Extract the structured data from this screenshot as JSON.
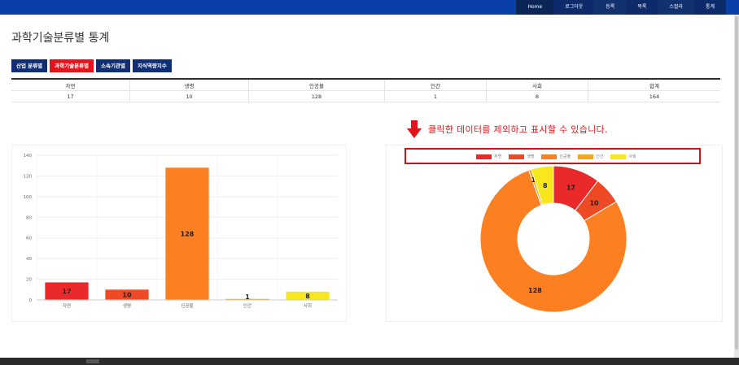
{
  "nav": {
    "items": [
      "Home",
      "로그아웃",
      "등록",
      "목록",
      "스컬라",
      "통계"
    ]
  },
  "page": {
    "title": "과학기술분류별 통계"
  },
  "tabs": [
    {
      "label": "산업 분류별",
      "active": false
    },
    {
      "label": "과학기술분류별",
      "active": true
    },
    {
      "label": "소속기관별",
      "active": false
    },
    {
      "label": "지식역량지수",
      "active": false
    }
  ],
  "table": {
    "headers": [
      "자연",
      "생명",
      "인공물",
      "인간",
      "사회",
      "합계"
    ],
    "values": [
      "17",
      "10",
      "128",
      "1",
      "8",
      "164"
    ]
  },
  "hint": {
    "text": "클릭한 데이터를 제외하고 표시할 수 있습니다."
  },
  "colors": {
    "nav_bg": "#0a3fa8",
    "tab_active": "#e8131a",
    "tab_default": "#0f2e75",
    "hint_red": "#e2141b"
  },
  "chart_data": [
    {
      "type": "bar",
      "categories": [
        "자연",
        "생명",
        "인공물",
        "인간",
        "사회"
      ],
      "values": [
        17,
        10,
        128,
        1,
        8
      ],
      "colors": [
        "#ea2a2a",
        "#ef4a26",
        "#fc7f22",
        "#f6a51c",
        "#f8e71c"
      ],
      "ylim": [
        0,
        140
      ],
      "yticks": [
        0,
        20,
        40,
        60,
        80,
        100,
        120,
        140
      ],
      "grid": true
    },
    {
      "type": "pie",
      "categories": [
        "자연",
        "생명",
        "인공물",
        "인간",
        "사회"
      ],
      "values": [
        17,
        10,
        128,
        1,
        8
      ],
      "colors": [
        "#ea2a2a",
        "#ef4a26",
        "#fc7f22",
        "#f6a51c",
        "#f8e71c"
      ],
      "legend": "top"
    }
  ]
}
